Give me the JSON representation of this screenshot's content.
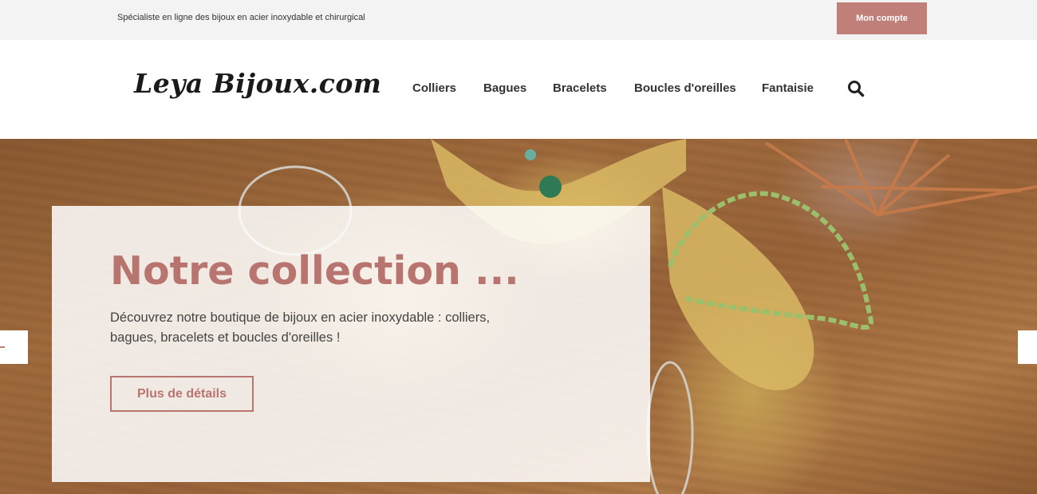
{
  "topbar": {
    "tagline": "Spécialiste en ligne des bijoux en acier inoxydable et chirurgical",
    "account_label": "Mon compte",
    "accent_color": "#c17f7a"
  },
  "header": {
    "logo_text": "Leya Bijoux.com",
    "nav": [
      {
        "label": "Colliers"
      },
      {
        "label": "Bagues"
      },
      {
        "label": "Bracelets"
      },
      {
        "label": "Boucles d'oreilles"
      },
      {
        "label": "Fantaisie"
      }
    ],
    "search_icon": "search-icon"
  },
  "hero": {
    "title": "Notre collection ...",
    "text": "Découvrez notre boutique de bijoux en acier inoxydable : colliers, bagues, bracelets et boucles d'oreilles !",
    "button_label": "Plus de détails",
    "title_color": "#b8746f",
    "prev_icon": "arrow-left-icon",
    "next_icon": "arrow-right-icon"
  }
}
